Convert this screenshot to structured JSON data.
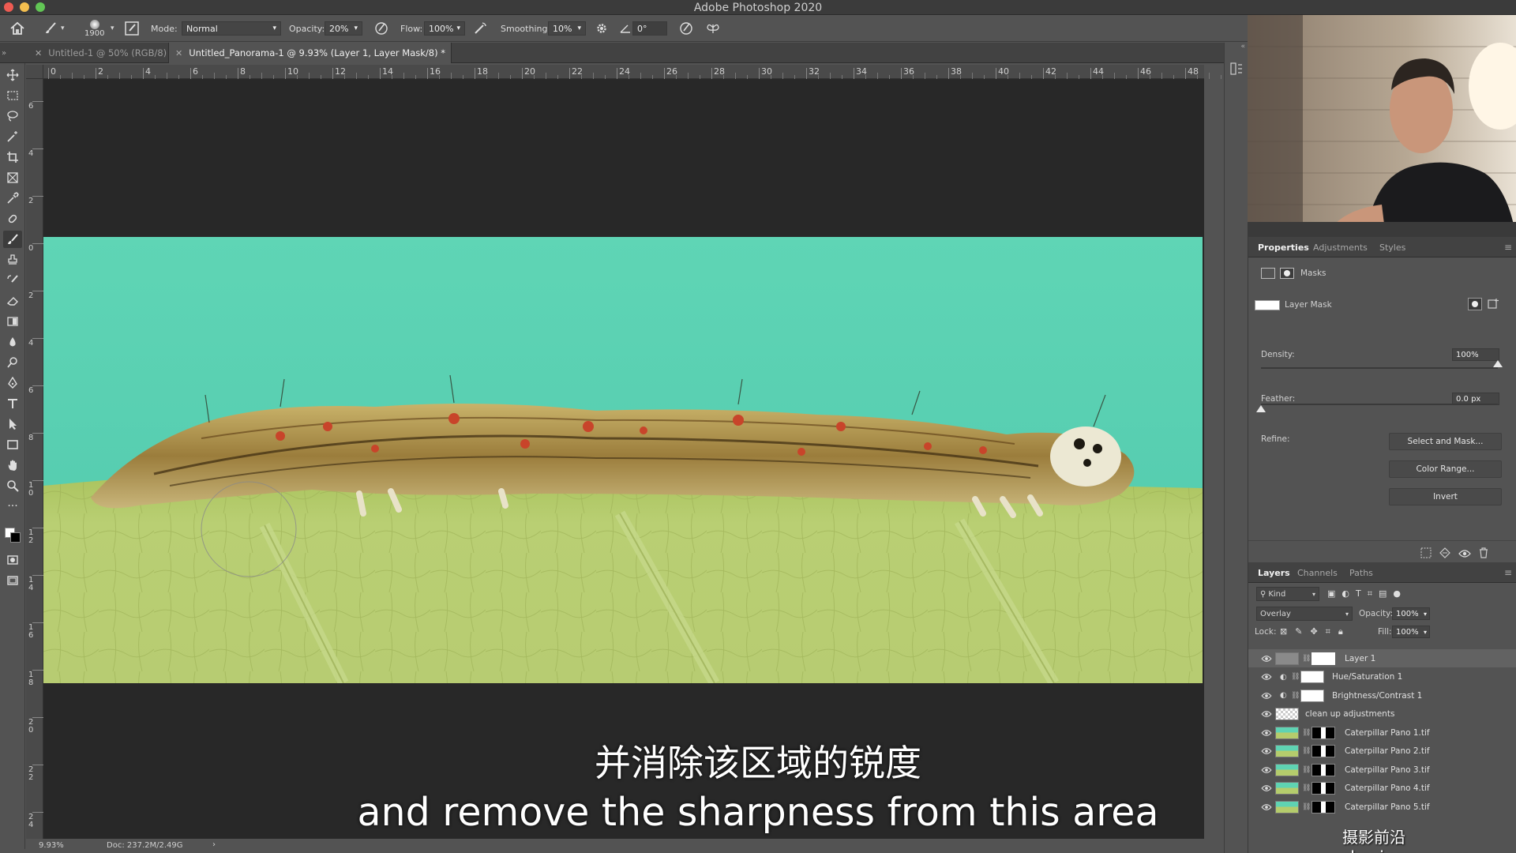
{
  "app": {
    "title": "Adobe Photoshop 2020"
  },
  "options": {
    "brush_size": "1900",
    "mode_label": "Mode:",
    "mode_value": "Normal",
    "opacity_label": "Opacity:",
    "opacity_value": "20%",
    "flow_label": "Flow:",
    "flow_value": "100%",
    "smoothing_label": "Smoothing:",
    "smoothing_value": "10%",
    "angle_value": "0°"
  },
  "tabs": [
    {
      "label": "Untitled-1 @ 50% (RGB/8)"
    },
    {
      "label": "Untitled_Panorama-1 @ 9.93% (Layer 1, Layer Mask/8) *"
    }
  ],
  "ruler": {
    "top": [
      "0",
      "2",
      "4",
      "6",
      "8",
      "10",
      "12",
      "14",
      "16",
      "18",
      "20",
      "22",
      "24",
      "26",
      "28",
      "30",
      "32",
      "34",
      "36",
      "38",
      "40",
      "42",
      "44",
      "46",
      "48"
    ],
    "left": [
      "6",
      "4",
      "2",
      "0",
      "2",
      "4",
      "6",
      "8",
      "1\n0",
      "1\n2",
      "1\n4",
      "1\n6",
      "1\n8",
      "2\n0",
      "2\n2",
      "2\n4"
    ]
  },
  "status": {
    "zoom": "9.93%",
    "doc": "Doc: 237.2M/2.49G"
  },
  "properties": {
    "tabs": [
      "Properties",
      "Adjustments",
      "Styles"
    ],
    "masks_label": "Masks",
    "layer_mask_label": "Layer Mask",
    "density_label": "Density:",
    "density_value": "100%",
    "density_level": 1.0,
    "feather_label": "Feather:",
    "feather_value": "0.0 px",
    "feather_level": 0.0,
    "refine_label": "Refine:",
    "select_mask_btn": "Select and Mask...",
    "color_range_btn": "Color Range...",
    "invert_btn": "Invert"
  },
  "layers_panel": {
    "tabs": [
      "Layers",
      "Channels",
      "Paths"
    ],
    "kind_label": "Kind",
    "blend_mode": "Overlay",
    "opacity_label": "Opacity:",
    "opacity_value": "100%",
    "lock_label": "Lock:",
    "fill_label": "Fill:",
    "fill_value": "100%",
    "layers": [
      {
        "name": "Layer 1",
        "selected": true
      },
      {
        "name": "Hue/Saturation 1"
      },
      {
        "name": "Brightness/Contrast 1"
      },
      {
        "name": "clean up adjustments"
      },
      {
        "name": "Caterpillar Pano 1.tif"
      },
      {
        "name": "Caterpillar Pano 2.tif"
      },
      {
        "name": "Caterpillar Pano 3.tif"
      },
      {
        "name": "Caterpillar Pano 4.tif"
      },
      {
        "name": "Caterpillar Pano 5.tif"
      }
    ]
  },
  "subtitles": {
    "cn": "并消除该区域的锐度",
    "en": "and remove the sharpness from this area"
  },
  "watermark": "摄影前沿 sheyingzyz.com",
  "colors": {
    "panel": "#535353",
    "canvas": "#282828",
    "sky": "#5fd3b3",
    "leaf": "#b5cc6c"
  }
}
